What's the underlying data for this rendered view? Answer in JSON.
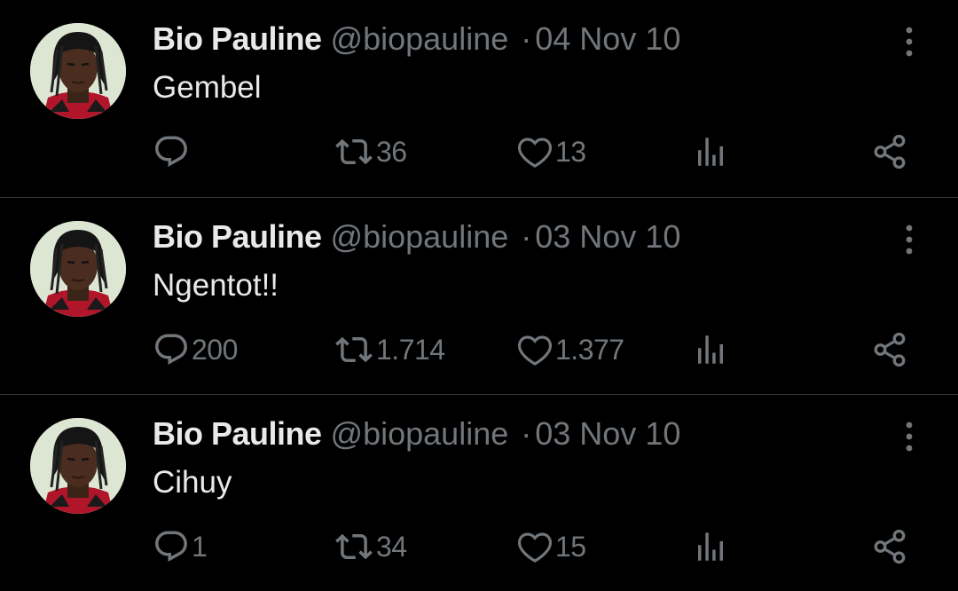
{
  "colors": {
    "background": "#000000",
    "text_primary": "#e7e9ea",
    "text_secondary": "#71767b",
    "divider": "#2f3336"
  },
  "icons": {
    "reply": "reply-icon",
    "retweet": "retweet-icon",
    "like": "heart-icon",
    "views": "views-icon",
    "share": "share-icon",
    "more": "more-options-icon"
  },
  "tweets": [
    {
      "name": "Bio Pauline",
      "handle": "@biopauline",
      "separator": "·",
      "date": "04 Nov 10",
      "text": "Gembel",
      "replies": "",
      "retweets": "36",
      "likes": "13"
    },
    {
      "name": "Bio Pauline",
      "handle": "@biopauline",
      "separator": "·",
      "date": "03 Nov 10",
      "text": "Ngentot!!",
      "replies": "200",
      "retweets": "1.714",
      "likes": "1.377"
    },
    {
      "name": "Bio Pauline",
      "handle": "@biopauline",
      "separator": "·",
      "date": "03 Nov 10",
      "text": "Cihuy",
      "replies": "1",
      "retweets": "34",
      "likes": "15"
    }
  ]
}
